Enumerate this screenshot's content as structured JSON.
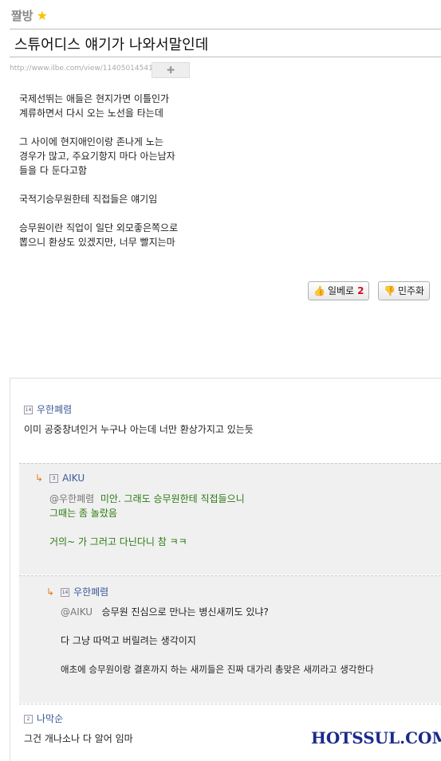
{
  "board": {
    "name": "짤방",
    "icon": "star-icon"
  },
  "post": {
    "title": "스튜어디스 얘기가 나와서말인데",
    "url": "http://www.ilbe.com/view/11405014541",
    "paragraphs": [
      "국제선뛰는 애들은 현지가면 이틀인가\n계류하면서 다시 오는 노선을 타는데",
      "그 사이에 현지애인이랑 존나게 노는\n경우가 많고, 주요기항지 마다 아는남자\n들을 다 둔다고함",
      "국적기승무원한테 직접들은 얘기임",
      "승무원이란 직업이 일단 외모좋은쪽으로\n뽑으니 환상도 있겠지만, 너무 빨지는마"
    ]
  },
  "votes": {
    "up_label": "일베로",
    "up_count": "2",
    "down_label": "민주화"
  },
  "comments": [
    {
      "level": "14",
      "nick": "우한폐렴",
      "lines": [
        "이미 공중창녀인거 누구나 아는데 너만 환상가지고 있는듯"
      ]
    },
    {
      "level": "3",
      "nick": "AIKU",
      "mention": "@우한폐렴",
      "lines": [
        "미안. 그래도 승무원한테 직접들으니",
        "그때는 좀 놀랐음",
        "거의~ 가 그러고 다닌다니 참 ㅋㅋ"
      ]
    },
    {
      "level": "14",
      "nick": "우한폐렴",
      "mention": "@AIKU",
      "lines": [
        "승무원 진심으로 만나는 병신새끼도 있냐?",
        "다 그냥 따먹고 버릴려는 생각이지",
        "애초에 승무원이랑 결혼까지 하는 새끼들은 진짜 대가리 총맞은 새끼라고 생각한다"
      ]
    },
    {
      "level": "2",
      "nick": "나막순",
      "lines": [
        "그건 개나소나 다 알어 임마"
      ]
    }
  ],
  "watermark": "HOTSSUL.COM"
}
